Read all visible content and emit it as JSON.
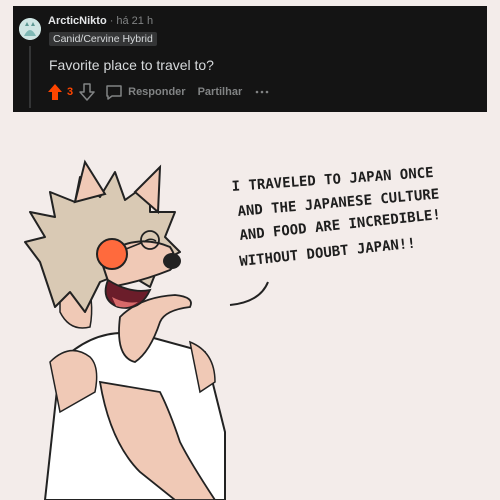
{
  "comment": {
    "author": "ArcticNikto",
    "timestamp": "há 21 h",
    "flair": "Canid/Cervine Hybrid",
    "body": "Favorite place to travel to?",
    "vote_count": "3",
    "actions": {
      "reply": "Responder",
      "share": "Partilhar"
    }
  },
  "artwork": {
    "speech": [
      "I TRAVELED TO JAPAN ONCE",
      "AND THE JAPANESE CULTURE",
      "AND FOOD ARE INCREDIBLE!",
      "WITHOUT DOUBT JAPAN!!"
    ]
  },
  "colors": {
    "upvote": "#ff4500",
    "card_bg": "#141414",
    "page_bg": "#f3ecea"
  },
  "icons": [
    "upvote-arrow-icon",
    "downvote-arrow-icon",
    "speech-bubble-icon",
    "more-icon"
  ]
}
